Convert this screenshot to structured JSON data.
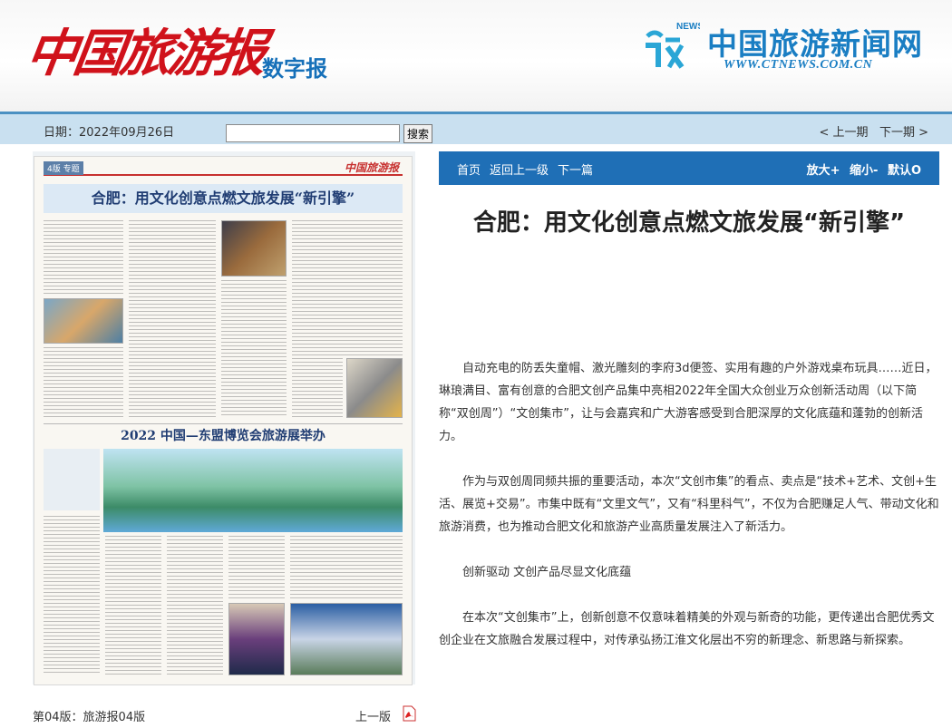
{
  "header": {
    "logo_text": "中国旅游报",
    "logo_sub": "数字报",
    "site_name": "中国旅游新闻网",
    "site_url": "WWW.CTNEWS.COM.CN",
    "site_logo_badge": "NEWS"
  },
  "topbar": {
    "date_label": "日期：",
    "date_value": "2022年09月26日",
    "search_value": "",
    "search_button": "搜索",
    "prev_issue": "< 上一期",
    "next_issue": "下一期 >"
  },
  "paper": {
    "edition": "4版  专题",
    "logo": "中国旅游报",
    "headline1": "合肥：用文化创意点燃文旅发展“新引擎”",
    "headline2": "2022 中国—东盟博览会旅游展举办"
  },
  "page_footer": {
    "label": "第04版：旅游报04版",
    "prev_page": "上一版"
  },
  "article_bar": {
    "home": "首页",
    "back": "返回上一级",
    "next": "下一篇",
    "zoom_in": "放大+",
    "zoom_out": "缩小-",
    "default": "默认O"
  },
  "article": {
    "title": "合肥：用文化创意点燃文旅发展“新引擎”",
    "paragraphs": [
      "自动充电的防丢失童帽、激光雕刻的李府3d便签、实用有趣的户外游戏桌布玩具……近日，琳琅满目、富有创意的合肥文创产品集中亮相2022年全国大众创业万众创新活动周（以下简称“双创周”）“文创集市”，让与会嘉宾和广大游客感受到合肥深厚的文化底蕴和蓬勃的创新活力。",
      "作为与双创周同频共振的重要活动，本次“文创市集”的看点、卖点是“技术+艺术、文创+生活、展览+交易”。市集中既有“文里文气”，又有“科里科气”，不仅为合肥赚足人气、带动文化和旅游消费，也为推动合肥文化和旅游产业高质量发展注入了新活力。",
      "创新驱动 文创产品尽显文化底蕴",
      "在本次“文创集市”上，创新创意不仅意味着精美的外观与新奇的功能，更传递出合肥优秀文创企业在文旅融合发展过程中，对传承弘扬江淮文化层出不穷的新理念、新思路与新探索。"
    ]
  },
  "colors": {
    "brand_red": "#d0121b",
    "brand_blue": "#1a7ec3",
    "bar_blue": "#1f6fb6",
    "topbar_bg": "#c9e0f0"
  }
}
